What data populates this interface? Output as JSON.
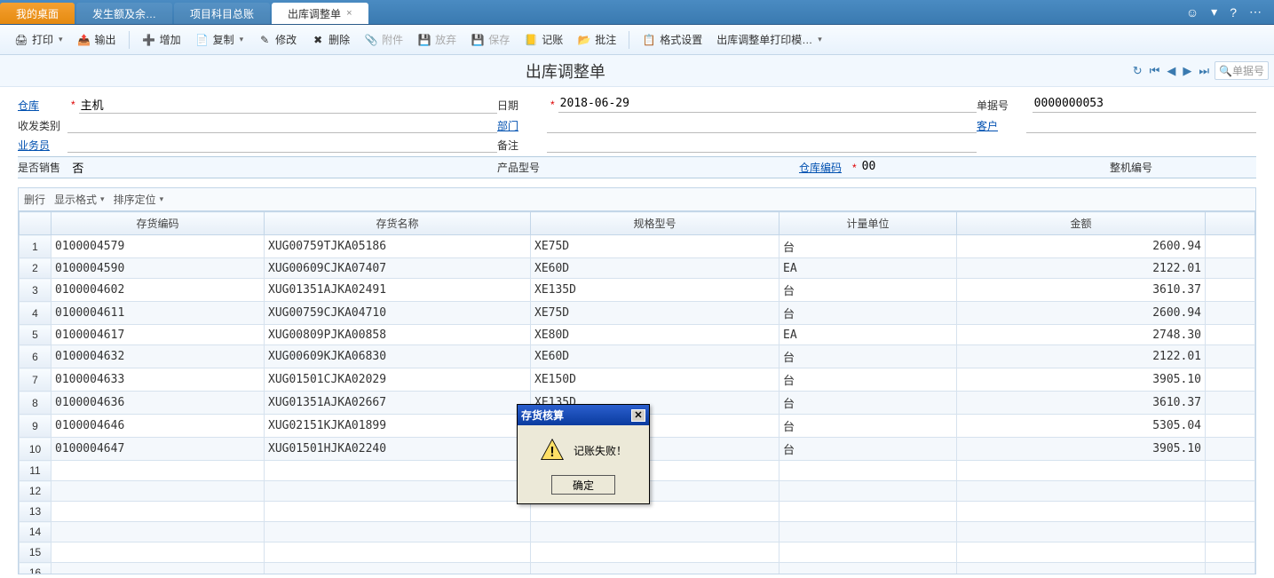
{
  "tabs": [
    {
      "label": "我的桌面",
      "type": "orange"
    },
    {
      "label": "发生额及余…",
      "type": "blue"
    },
    {
      "label": "项目科目总账",
      "type": "blue"
    },
    {
      "label": "出库调整单",
      "type": "active"
    }
  ],
  "toolbar": {
    "print": "打印",
    "output": "输出",
    "add": "增加",
    "copy": "复制",
    "modify": "修改",
    "delete": "删除",
    "attach": "附件",
    "discard": "放弃",
    "save": "保存",
    "post": "记账",
    "batch": "批注",
    "format": "格式设置",
    "printTpl": "出库调整单打印模…"
  },
  "pageTitle": "出库调整单",
  "searchPlaceholder": "单据号",
  "form": {
    "labels": {
      "warehouse": "仓库",
      "rdtype": "收发类别",
      "operator": "业务员",
      "isSale": "是否销售",
      "date": "日期",
      "dept": "部门",
      "memo": "备注",
      "productModel": "产品型号",
      "docNo": "单据号",
      "customer": "客户",
      "whCode": "仓库编码",
      "machineNo": "整机编号"
    },
    "values": {
      "warehouse": "主机",
      "isSale": "否",
      "date": "2018-06-29",
      "docNo": "0000000053",
      "whCode": "00"
    }
  },
  "tableToolbar": {
    "delRow": "删行",
    "displayFmt": "显示格式",
    "sortLocate": "排序定位"
  },
  "columns": [
    "",
    "存货编码",
    "存货名称",
    "规格型号",
    "计量单位",
    "金额",
    ""
  ],
  "rows": [
    {
      "code": "0100004579",
      "name": "XUG00759TJKA05186",
      "spec": "XE75D",
      "unit": "台",
      "amount": "2600.94"
    },
    {
      "code": "0100004590",
      "name": "XUG00609CJKA07407",
      "spec": "XE60D",
      "unit": "EA",
      "amount": "2122.01"
    },
    {
      "code": "0100004602",
      "name": "XUG01351AJKA02491",
      "spec": "XE135D",
      "unit": "台",
      "amount": "3610.37"
    },
    {
      "code": "0100004611",
      "name": "XUG00759CJKA04710",
      "spec": "XE75D",
      "unit": "台",
      "amount": "2600.94"
    },
    {
      "code": "0100004617",
      "name": "XUG00809PJKA00858",
      "spec": "XE80D",
      "unit": "EA",
      "amount": "2748.30"
    },
    {
      "code": "0100004632",
      "name": "XUG00609KJKA06830",
      "spec": "XE60D",
      "unit": "台",
      "amount": "2122.01"
    },
    {
      "code": "0100004633",
      "name": "XUG01501CJKA02029",
      "spec": "XE150D",
      "unit": "台",
      "amount": "3905.10"
    },
    {
      "code": "0100004636",
      "name": "XUG01351AJKA02667",
      "spec": "XE135D",
      "unit": "台",
      "amount": "3610.37"
    },
    {
      "code": "0100004646",
      "name": "XUG02151KJKA01899",
      "spec": "",
      "unit": "台",
      "amount": "5305.04"
    },
    {
      "code": "0100004647",
      "name": "XUG01501HJKA02240",
      "spec": "",
      "unit": "台",
      "amount": "3905.10"
    }
  ],
  "emptyRows": 6,
  "dialog": {
    "title": "存货核算",
    "message": "记账失败！",
    "ok": "确定"
  }
}
